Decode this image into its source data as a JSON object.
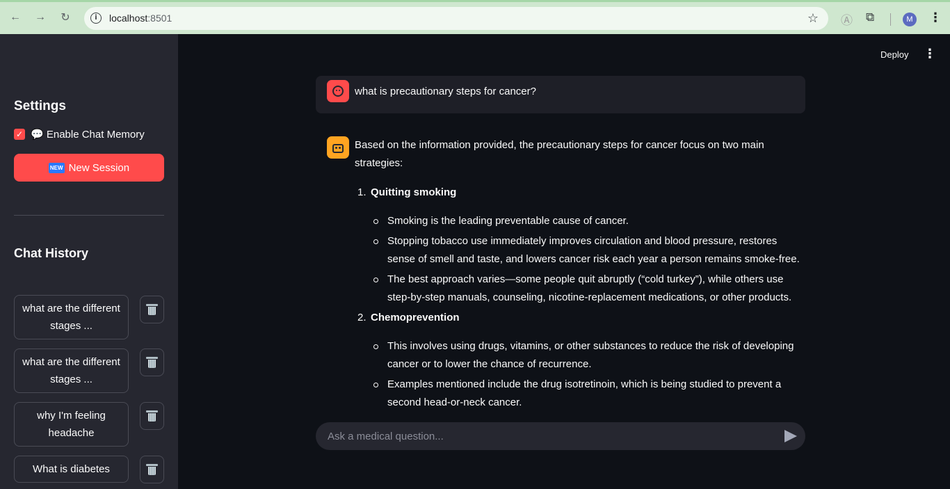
{
  "browser": {
    "url_host": "localhost",
    "url_port": ":8501",
    "profile_initial": "M"
  },
  "sidebar": {
    "settings_title": "Settings",
    "memory_label": "💬 Enable Chat Memory",
    "memory_checked": true,
    "new_session_badge": "NEW",
    "new_session_label": "New Session",
    "history_title": "Chat History",
    "history": [
      {
        "label": "what are the different stages ..."
      },
      {
        "label": "what are the different stages ..."
      },
      {
        "label": "why I'm feeling headache"
      },
      {
        "label": "What is diabetes"
      }
    ]
  },
  "header": {
    "deploy_label": "Deploy"
  },
  "chat": {
    "user_message": "what is precautionary steps for cancer?",
    "bot_intro": "Based on the information provided, the precautionary steps for cancer focus on two main strategies:",
    "sections": [
      {
        "num": "1.",
        "title": "Quitting smoking",
        "bullets": [
          "Smoking is the leading preventable cause of cancer.",
          "Stopping tobacco use immediately improves circulation and blood pressure, restores sense of smell and taste, and lowers cancer risk each year a person remains smoke-free.",
          "The best approach varies—some people quit abruptly (“cold turkey”), while others use step-by-step manuals, counseling, nicotine-replacement medications, or other products."
        ]
      },
      {
        "num": "2.",
        "title": "Chemoprevention",
        "bullets": [
          "This involves using drugs, vitamins, or other substances to reduce the risk of developing cancer or to lower the chance of recurrence.",
          "Examples mentioned include the drug isotretinoin, which is being studied to prevent a second head-or-neck cancer."
        ]
      }
    ],
    "input_placeholder": "Ask a medical question..."
  },
  "colors": {
    "accent": "#ff4b4b",
    "bot_avatar": "#ffa421",
    "sidebar_bg": "#262730",
    "main_bg": "#0e1117"
  }
}
